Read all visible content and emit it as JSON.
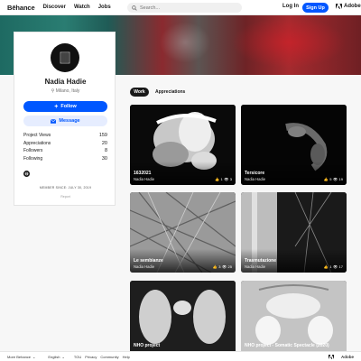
{
  "nav": {
    "logo": "Bēhance",
    "links": [
      "Discover",
      "Watch",
      "Jobs"
    ],
    "search_placeholder": "Search...",
    "login": "Log In",
    "signup": "Sign Up",
    "adobe": "Adobe"
  },
  "profile": {
    "name": "Nadia Hadie",
    "location": "Milano, Italy",
    "follow": "Follow",
    "message": "Message",
    "stats": [
      {
        "label": "Project Views",
        "value": "159"
      },
      {
        "label": "Appreciations",
        "value": "20"
      },
      {
        "label": "Followers",
        "value": "8"
      },
      {
        "label": "Following",
        "value": "30"
      }
    ],
    "member_since": "MEMBER SINCE: JULY 30, 2019",
    "report": "Report"
  },
  "tabs": {
    "work": "Work",
    "appreciations": "Appreciations"
  },
  "projects": [
    {
      "title": "1632021",
      "owner": "Nadia Hadie",
      "likes": "1",
      "views": "3"
    },
    {
      "title": "Tersicore",
      "owner": "Nadia Hadie",
      "likes": "5",
      "views": "19"
    },
    {
      "title": "Le sembianze",
      "owner": "Nadia Hadie",
      "likes": "3",
      "views": "25"
    },
    {
      "title": "Trasmutazione",
      "owner": "Nadia Hadie",
      "likes": "1",
      "views": "17"
    },
    {
      "title": "NHO project",
      "owner": "",
      "likes": "",
      "views": ""
    },
    {
      "title": "NHO project - Somatic Spectacle (2020)",
      "owner": "",
      "likes": "",
      "views": ""
    }
  ],
  "footer": {
    "more": "More Behance",
    "lang": "English",
    "links": [
      "TOU",
      "Privacy",
      "Community",
      "Help"
    ],
    "adobe": "Adobe"
  },
  "colors": {
    "accent": "#0057ff",
    "text": "#191919",
    "background": "#f7f7f7"
  }
}
